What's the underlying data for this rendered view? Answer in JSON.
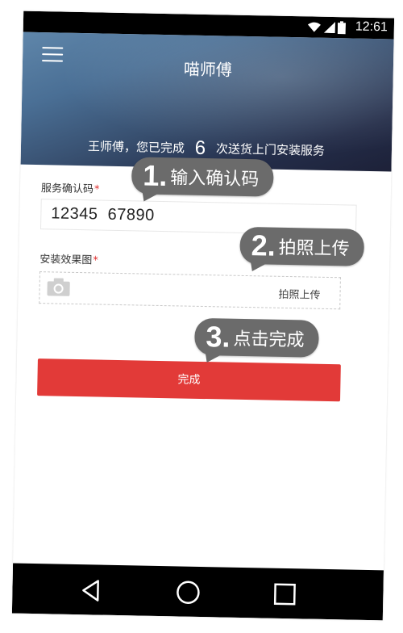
{
  "status_bar": {
    "time": "12:61"
  },
  "header": {
    "menu_icon": "menu-icon",
    "title": "喵师傅",
    "completion_prefix": "王师傅，您已完成",
    "completion_count": "6",
    "completion_suffix": "次送货上门安装服务"
  },
  "form": {
    "code_label": "服务确认码",
    "code_required_mark": "*",
    "code_value": "12345  67890",
    "photo_label": "安装效果图",
    "photo_required_mark": "*",
    "photo_icon": "camera-icon",
    "photo_upload_text": "拍照上传",
    "submit_label": "完成"
  },
  "callouts": [
    {
      "num": "1.",
      "text": "输入确认码"
    },
    {
      "num": "2.",
      "text": "拍照上传"
    },
    {
      "num": "3.",
      "text": "点击完成"
    }
  ],
  "nav": {
    "back_icon": "back-triangle-icon",
    "home_icon": "home-circle-icon",
    "recents_icon": "recents-square-icon"
  },
  "colors": {
    "accent": "#e23a38",
    "callout_bg": "#6b6b6b"
  }
}
